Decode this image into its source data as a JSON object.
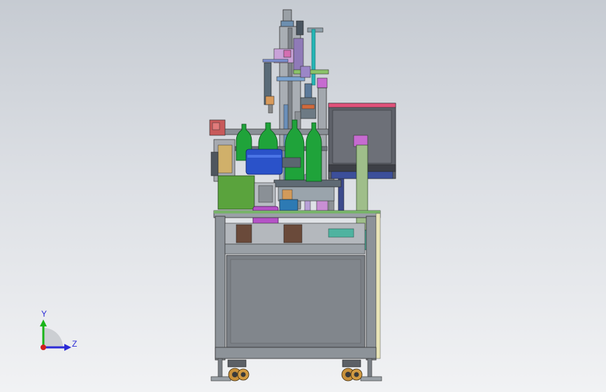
{
  "viewport": {
    "background_top": "#c6cbd2",
    "background_bottom": "#f1f2f4"
  },
  "triad": {
    "y_label": "Y",
    "z_label": "Z",
    "y_color": "#19b419",
    "z_color": "#2b2bd6",
    "origin_color": "#d21e1e"
  },
  "model": {
    "frame_color": "#8d9399",
    "panel_color": "#7a7f85",
    "bottle_color": "#1fa33a",
    "motor_green": "#5aa33d",
    "cylinder_magenta": "#b552c7",
    "hopper_blue": "#2a52c9",
    "control_box_color": "#5d6068",
    "control_box_trim": "#e0517a"
  }
}
